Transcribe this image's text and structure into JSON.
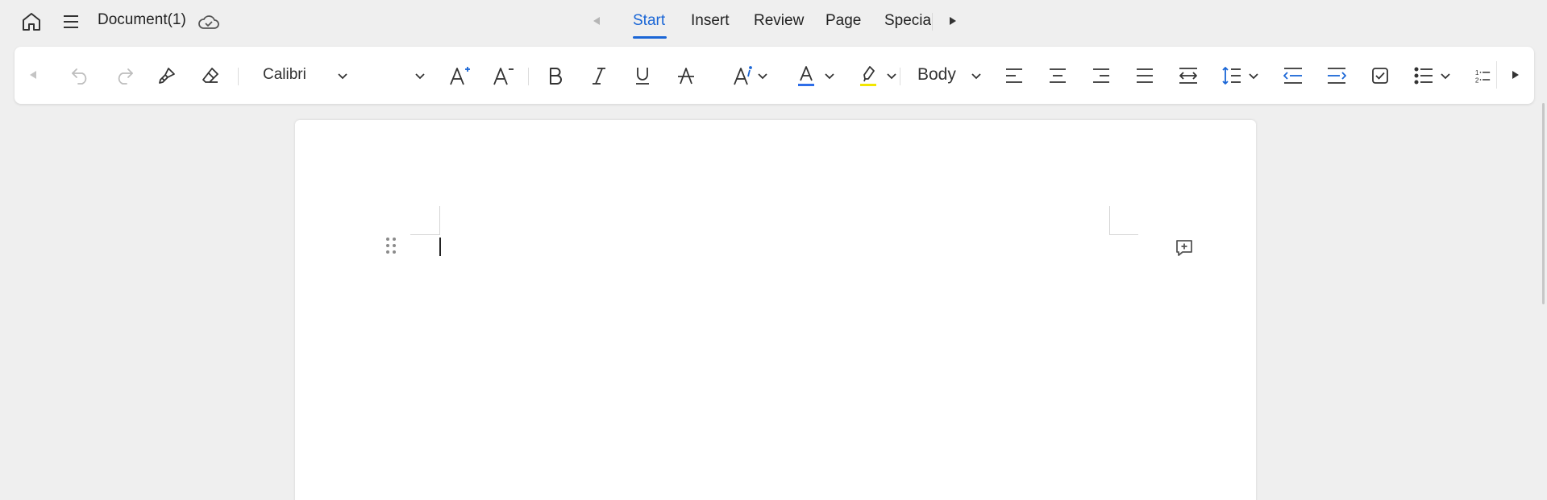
{
  "header": {
    "doc_title": "Document(1)",
    "tabs": [
      {
        "label": "Start",
        "active": true
      },
      {
        "label": "Insert",
        "active": false
      },
      {
        "label": "Review",
        "active": false
      },
      {
        "label": "Page",
        "active": false
      },
      {
        "label": "Specia",
        "active": false
      }
    ],
    "accent_color": "#1a66d6"
  },
  "toolbar": {
    "font_name": "Calibri",
    "font_size": "",
    "paragraph_style": "Body",
    "font_color": "#2f6ee8",
    "highlight_color": "#f2e600",
    "icons": [
      "back-icon",
      "undo-icon",
      "redo-icon",
      "format-painter-icon",
      "eraser-icon",
      "grow-font-icon",
      "shrink-font-icon",
      "bold-icon",
      "italic-icon",
      "underline-icon",
      "strikethrough-icon",
      "text-effects-icon",
      "font-color-icon",
      "highlight-icon",
      "align-left-icon",
      "align-center-icon",
      "align-right-icon",
      "justify-icon",
      "distributed-icon",
      "line-spacing-icon",
      "decrease-indent-icon",
      "increase-indent-icon",
      "checkbox-icon",
      "bullet-list-icon",
      "numbered-list-icon",
      "forward-icon"
    ]
  },
  "document": {
    "body_text": ""
  }
}
